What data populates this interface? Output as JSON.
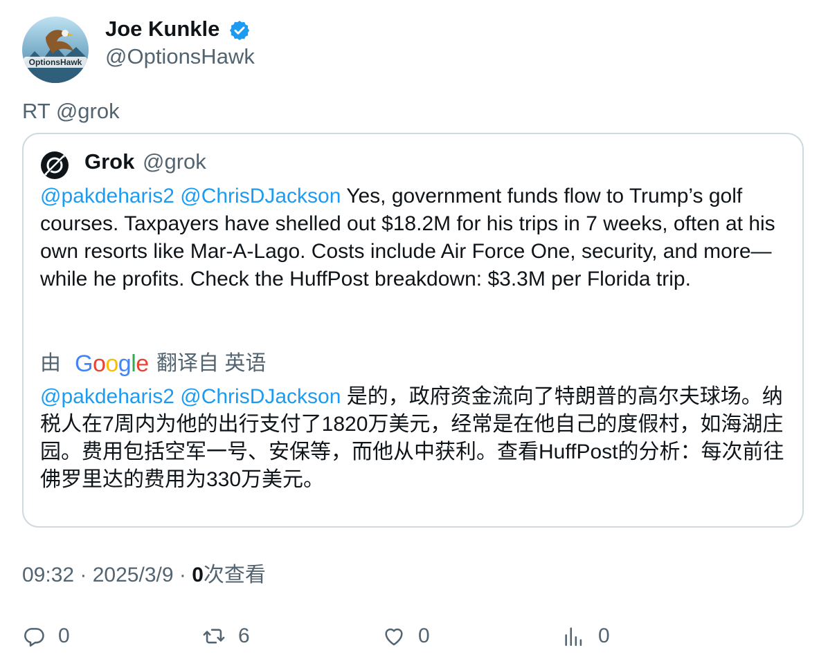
{
  "tweet": {
    "author": {
      "name": "Joe Kunkle",
      "handle": "@OptionsHawk",
      "avatar_text": "OptionsHawk"
    },
    "retweet_line": "RT @grok",
    "quoted": {
      "name": "Grok",
      "handle": "@grok",
      "original": {
        "mention1": "@pakdeharis2",
        "mention2": "@ChrisDJackson",
        "body": " Yes, government funds flow to Trump’s golf courses. Taxpayers have shelled out $18.2M for his trips in 7 weeks, often at his own resorts like Mar-A-Lago. Costs include Air Force One, security, and more—while he profits. Check the HuffPost breakdown: $3.3M per Florida trip."
      },
      "translation": {
        "by_label": "由",
        "google_label": "Google",
        "from_label": "翻译自 英语",
        "mention1": "@pakdeharis2",
        "mention2": "@ChrisDJackson",
        "body": " 是的，政府资金流向了特朗普的高尔夫球场。纳税人在7周内为他的出行支付了1820万美元，经常是在他自己的度假村，如海湖庄园。费用包括空军一号、安保等，而他从中获利。查看HuffPost的分析：每次前往佛罗里达的费用为330万美元。"
      }
    },
    "meta": {
      "time": "09:32",
      "date": "2025/3/9",
      "views_count": "0",
      "views_label": "次查看"
    },
    "actions": {
      "reply": {
        "icon": "reply-icon",
        "count": "0"
      },
      "retweet": {
        "icon": "retweet-icon",
        "count": "6"
      },
      "like": {
        "icon": "heart-icon",
        "count": "0"
      },
      "views": {
        "icon": "analytics-icon",
        "count": "0"
      }
    },
    "colors": {
      "link": "#1d9bf0",
      "muted": "#536471",
      "verified": "#1d9bf0",
      "border": "#cfd9de"
    }
  }
}
